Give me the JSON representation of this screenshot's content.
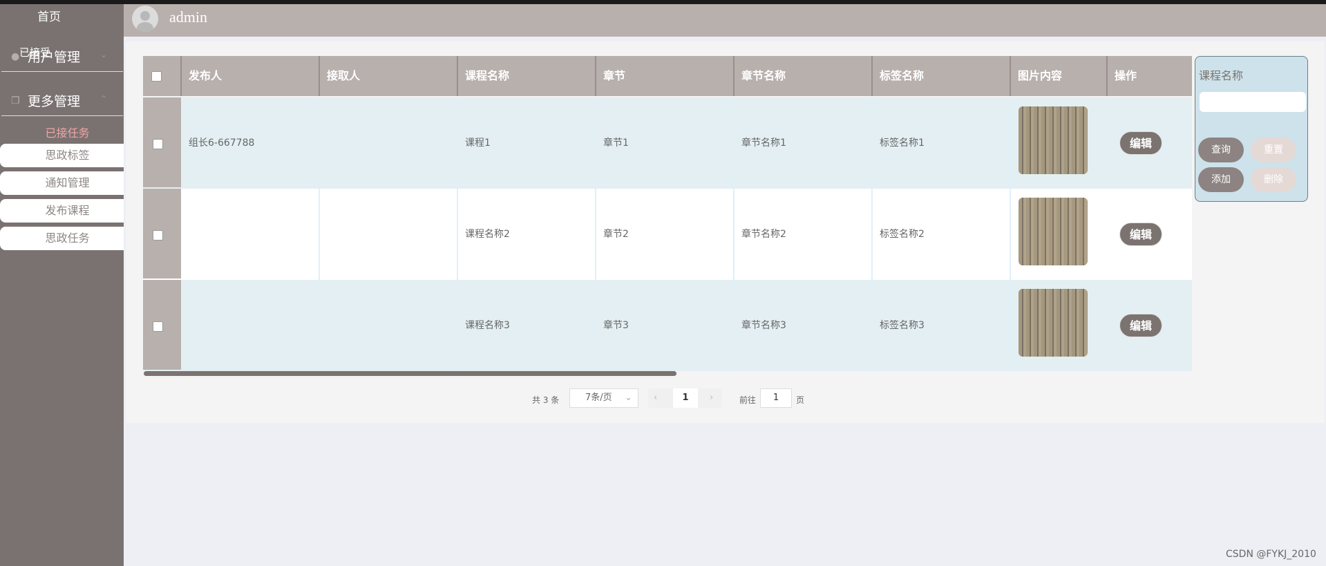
{
  "sidebar": {
    "home": "首页",
    "user_group": "用户管理",
    "more_group": "更多管理",
    "overlay_text": "已接受",
    "active_item": "已接任务",
    "items": [
      "思政标签",
      "通知管理",
      "发布课程",
      "思政任务"
    ]
  },
  "header": {
    "username": "admin"
  },
  "table": {
    "columns": [
      "发布人",
      "接取人",
      "课程名称",
      "章节",
      "章节名称",
      "标签名称",
      "图片内容",
      "操作"
    ],
    "rows": [
      {
        "publisher": "组长6-667788",
        "receiver": "",
        "course": "课程1",
        "chapter": "章节1",
        "chapter_name": "章节名称1",
        "tag": "标签名称1"
      },
      {
        "publisher": "",
        "receiver": "",
        "course": "课程名称2",
        "chapter": "章节2",
        "chapter_name": "章节名称2",
        "tag": "标签名称2"
      },
      {
        "publisher": "",
        "receiver": "",
        "course": "课程名称3",
        "chapter": "章节3",
        "chapter_name": "章节名称3",
        "tag": "标签名称3"
      }
    ],
    "edit_label": "编辑"
  },
  "pagination": {
    "total": "共 3 条",
    "page_size": "7条/页",
    "current": "1",
    "goto_label": "前往",
    "goto_value": "1",
    "page_suffix": "页"
  },
  "search": {
    "label": "课程名称",
    "query": "查询",
    "reset": "重置",
    "add": "添加",
    "delete": "删除"
  },
  "watermark": "CSDN @FYKJ_2010",
  "icons": {
    "user_group_icon": "user-icon",
    "more_group_icon": "copy-icon",
    "chevron": "chevron-down-icon"
  }
}
